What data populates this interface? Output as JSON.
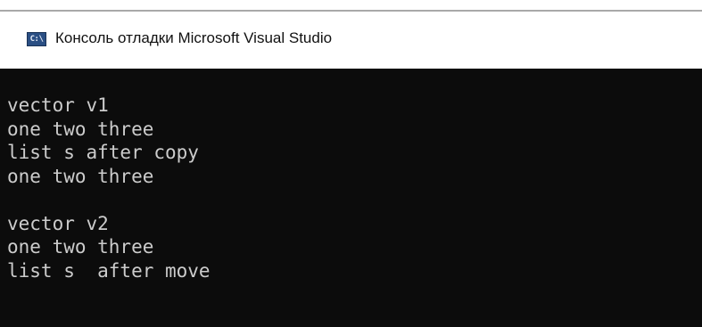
{
  "window": {
    "title": "Консоль отладки Microsoft Visual Studio",
    "icon_label": "C:\\",
    "icon": "console-app-icon"
  },
  "console": {
    "lines": [
      "vector v1",
      "one two three",
      "list s after copy",
      "one two three",
      "",
      "vector v2",
      "one two three",
      "list s  after move"
    ]
  },
  "colors": {
    "console_background": "#0c0c0c",
    "console_text": "#cccccc",
    "titlebar_background": "#ffffff"
  }
}
